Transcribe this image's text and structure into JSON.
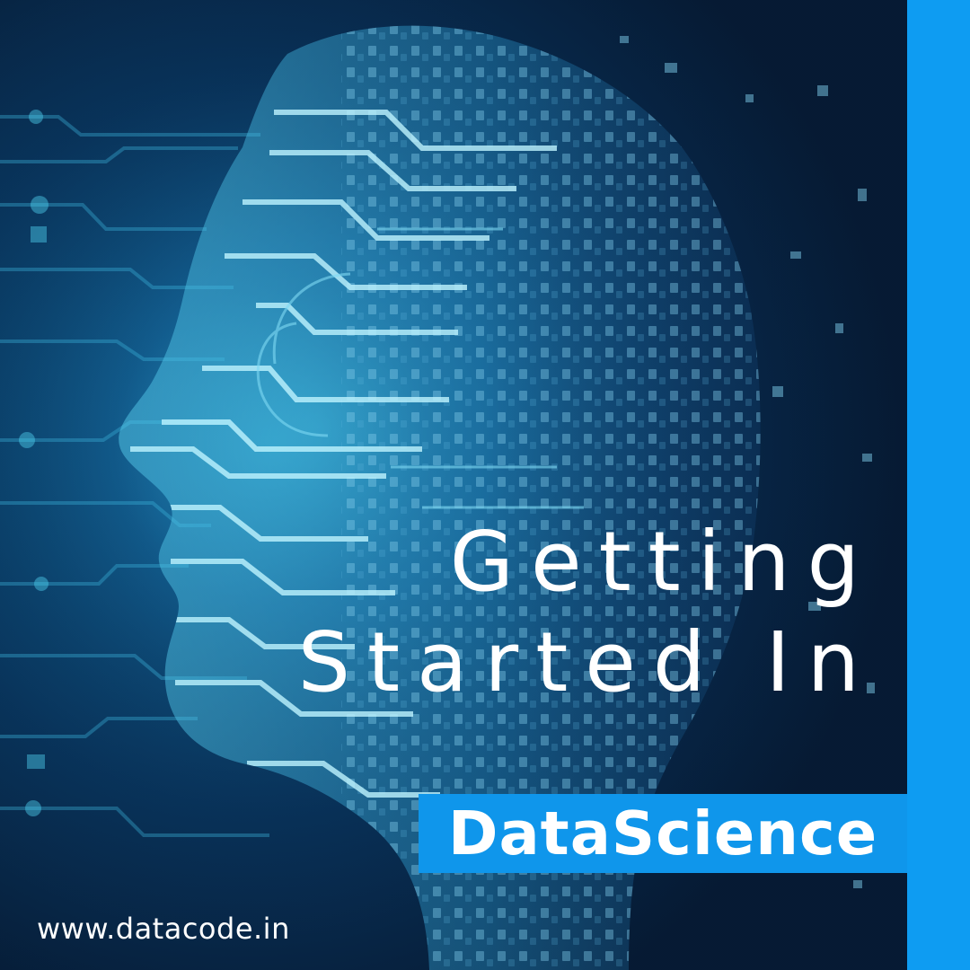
{
  "headline": {
    "line1": "Getting",
    "line2": "Started In"
  },
  "badge": {
    "text": "DataScience"
  },
  "footer": {
    "url": "www.datacode.in"
  },
  "colors": {
    "accent": "#0e9cf2",
    "background_dark": "#06142c",
    "circuit_glow": "#38bfe3",
    "text": "#ffffff"
  },
  "icons": {
    "background": "ai-circuit-head-icon"
  }
}
